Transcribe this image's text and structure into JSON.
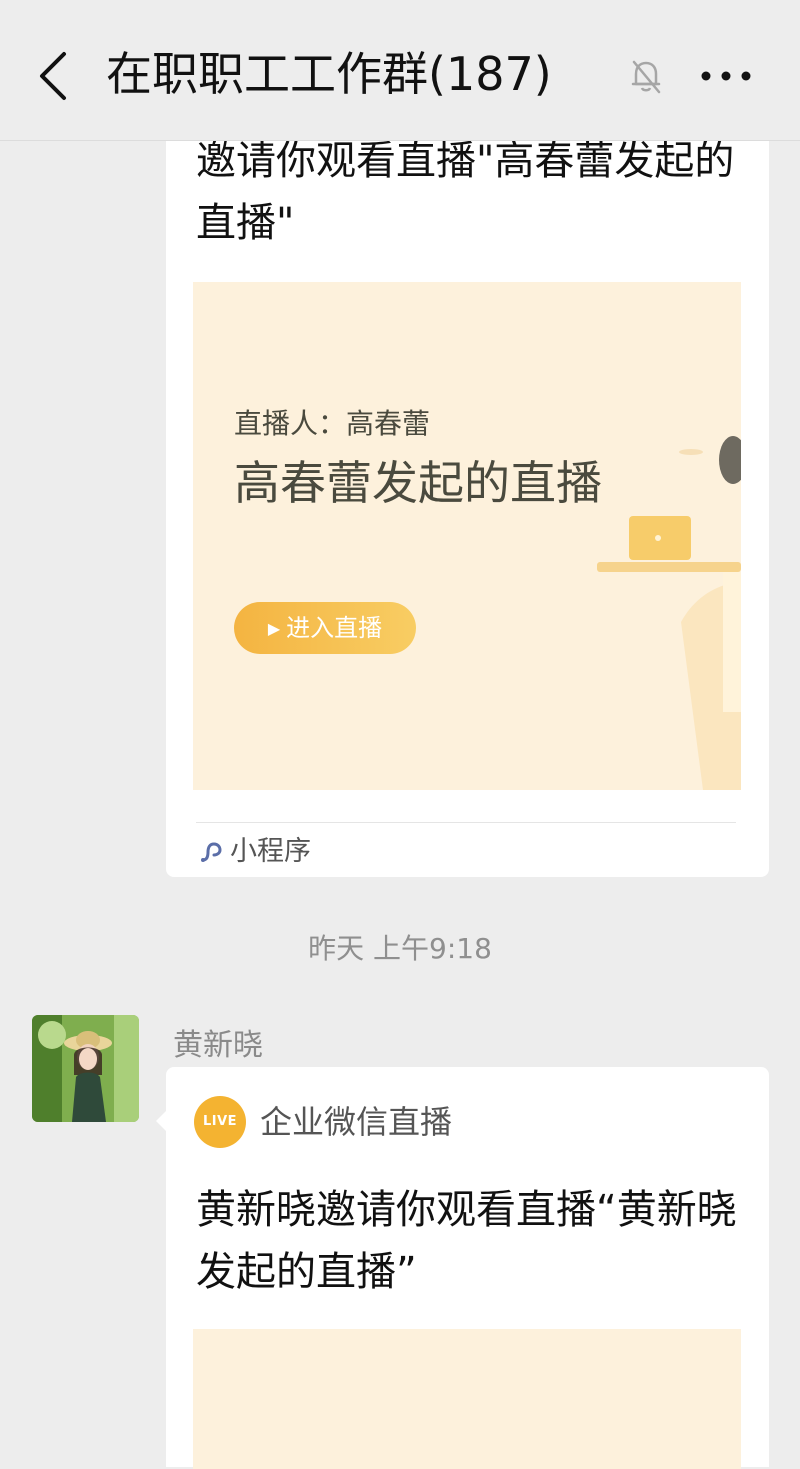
{
  "header": {
    "title": "在职职工工作群(187)",
    "back_icon": "chevron-left-icon",
    "mute_icon": "bell-off-icon",
    "more_icon": "more-dots-icon"
  },
  "messages": [
    {
      "invite_text": "邀请你观看直播\"高春蕾发起的直播\"",
      "preview": {
        "streamer": "直播人：高春蕾",
        "title": "高春蕾发起的直播",
        "button": "进入直播"
      },
      "footer_label": "小程序"
    },
    {
      "timestamp": "昨天 上午9:18",
      "sender": "黄新晓",
      "badge": "LIVE",
      "source": "企业微信直播",
      "invite_text": "黄新晓邀请你观看直播“黄新晓发起的直播”"
    }
  ],
  "colors": {
    "background": "#ededed",
    "card": "#ffffff",
    "preview_bg": "#fdf1dc",
    "accent": "#f4b441",
    "badge": "#f4b331",
    "mini_program_icon": "#5b6ea8"
  }
}
